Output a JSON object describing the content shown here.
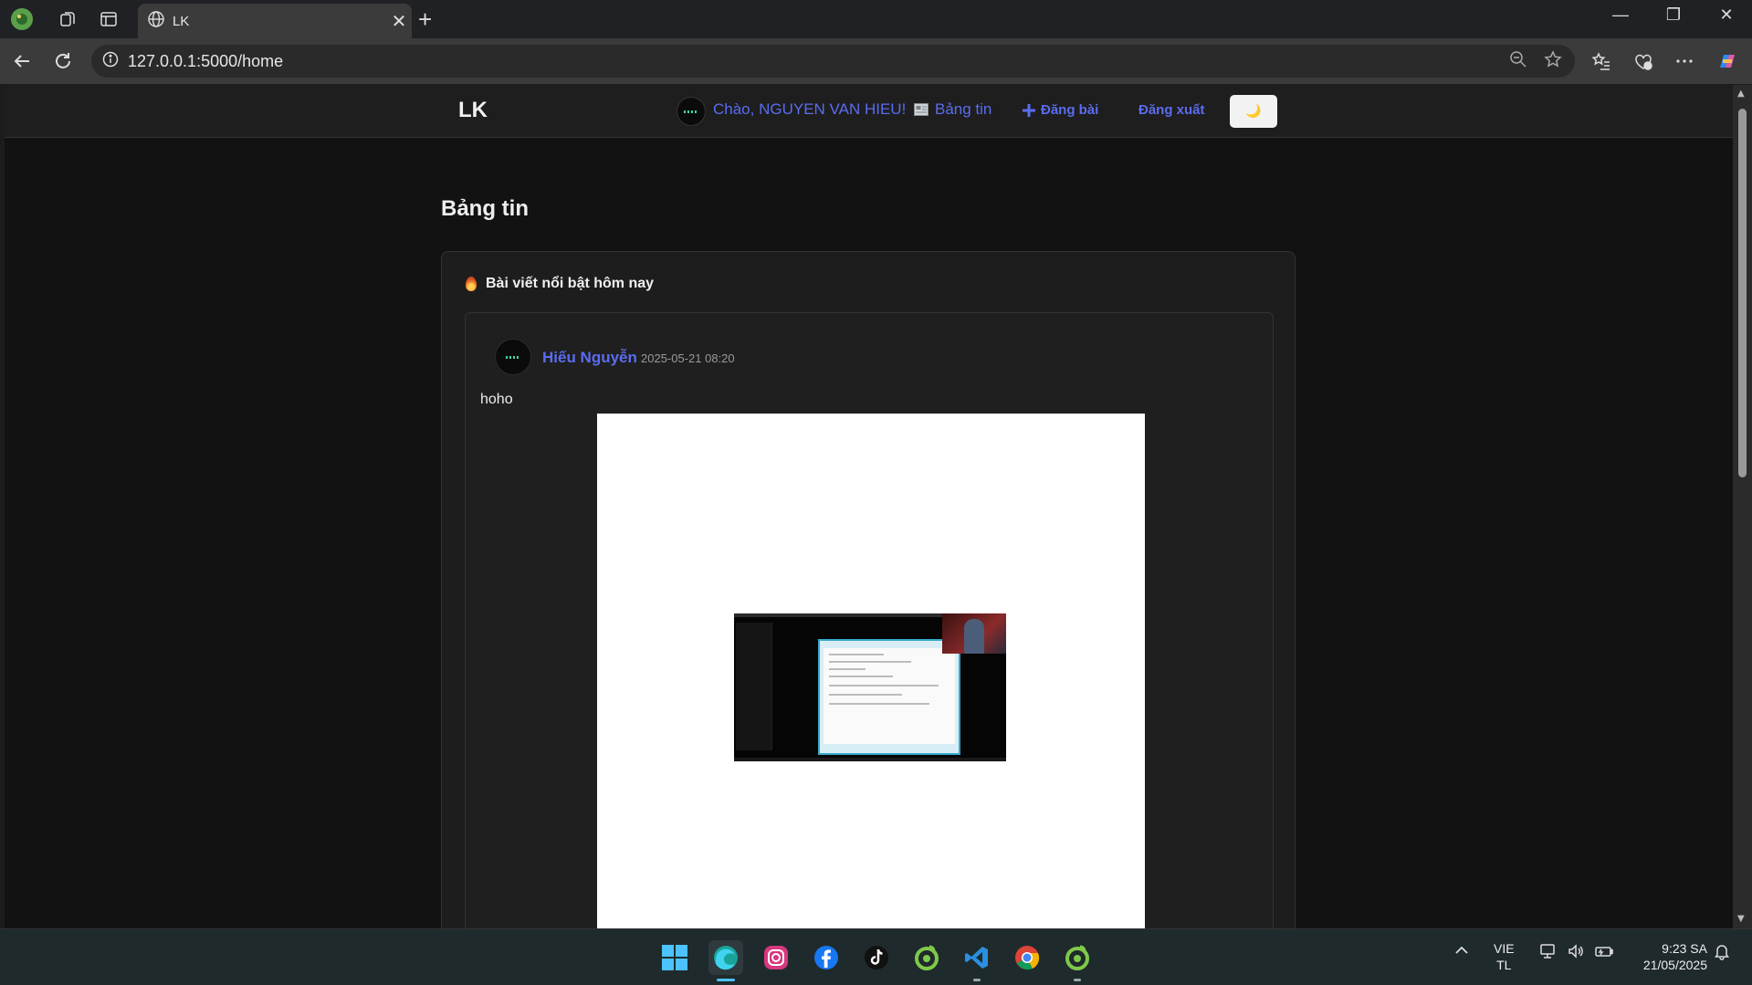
{
  "browser": {
    "tab_title": "LK",
    "url": "127.0.0.1:5000/home"
  },
  "site": {
    "brand": "LK",
    "greeting": "Chào, NGUYEN VAN HIEU!",
    "nav": {
      "feed": "Bảng tin",
      "post": "Đăng bài",
      "logout": "Đăng xuất"
    },
    "theme_toggle_icon": "🌙"
  },
  "page": {
    "title": "Bảng tin",
    "featured": {
      "heading": "Bài viết nổi bật hôm nay",
      "post": {
        "author": "Hiếu Nguyễn",
        "timestamp": "2025-05-21 08:20",
        "text": "hoho"
      }
    }
  },
  "taskbar": {
    "language_line1": "VIE",
    "language_line2": "TL",
    "time": "9:23 SA",
    "date": "21/05/2025",
    "apps": [
      "start-icon",
      "edge-icon",
      "instagram-icon",
      "facebook-icon",
      "tiktok-icon",
      "coccoc-icon",
      "vscode-icon",
      "chrome-icon",
      "coccoc-icon"
    ]
  }
}
